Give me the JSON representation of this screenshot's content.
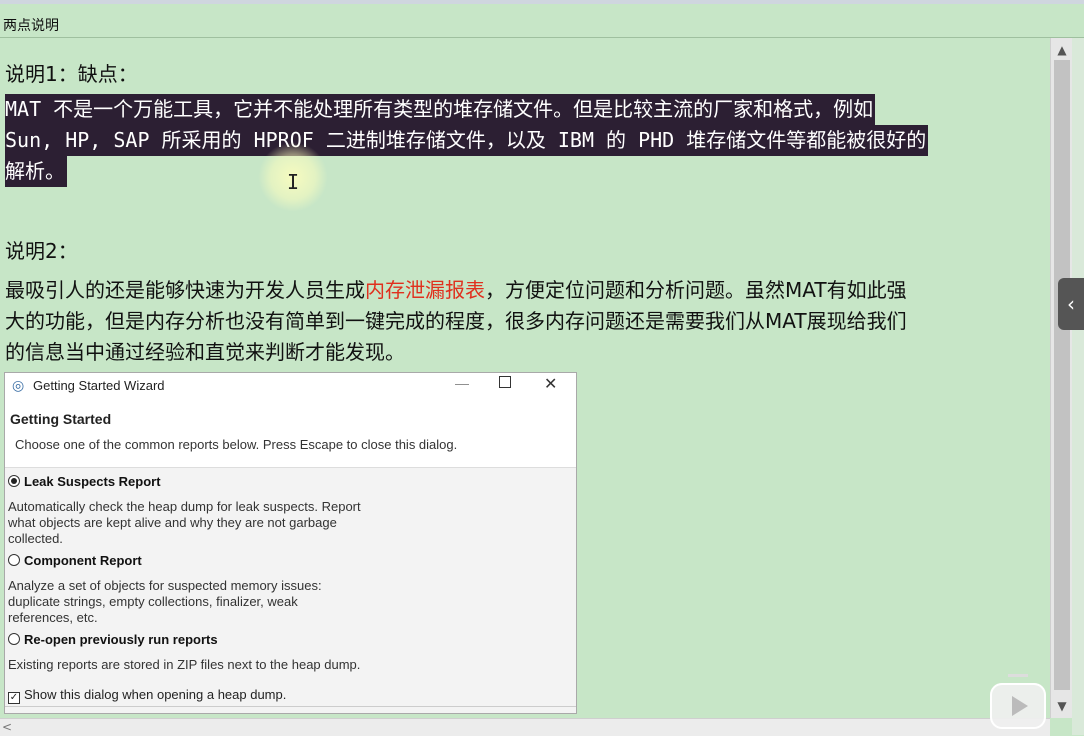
{
  "window": {
    "title": "两点说明"
  },
  "note1": {
    "heading": "说明1：缺点：",
    "line1": "MAT 不是一个万能工具，它并不能处理所有类型的堆存储文件。但是比较主流的厂家和格式，例如",
    "line2": "Sun, HP, SAP 所采用的 HPROF 二进制堆存储文件，以及 IBM 的 PHD 堆存储文件等都能被很好的",
    "line3": "解析。"
  },
  "note2": {
    "heading": "说明2：",
    "line1_a": "最吸引人的还是能够快速为开发人员生成",
    "line1_red": "内存泄漏报表",
    "line1_b": "，方便定位问题和分析问题。虽然MAT有如此强",
    "line2": "大的功能，但是内存分析也没有简单到一键完成的程度，很多内存问题还是需要我们从MAT展现给我们",
    "line3": "的信息当中通过经验和直觉来判断才能发现。"
  },
  "dialog": {
    "title": "Getting Started Wizard",
    "heading": "Getting Started",
    "subtitle": "Choose one of the common reports below. Press Escape to close this dialog.",
    "options": [
      {
        "label": "Leak Suspects Report",
        "selected": true,
        "desc": [
          "Automatically check the heap dump for leak suspects. Report",
          "what objects are kept alive and why they are not garbage",
          "collected."
        ]
      },
      {
        "label": "Component Report",
        "selected": false,
        "desc": [
          "Analyze a set of objects for suspected memory issues:",
          "duplicate strings, empty collections, finalizer, weak",
          "references, etc."
        ]
      },
      {
        "label": "Re-open previously run reports",
        "selected": false,
        "desc": [
          "Existing reports are stored in ZIP files next to the heap dump."
        ]
      }
    ],
    "checkbox_label": "Show this dialog when opening a heap dump.",
    "checkbox_checked": true
  },
  "colors": {
    "background": "#c7e6c7",
    "selection": "#2c1f33",
    "highlight_text": "#e0301e"
  }
}
